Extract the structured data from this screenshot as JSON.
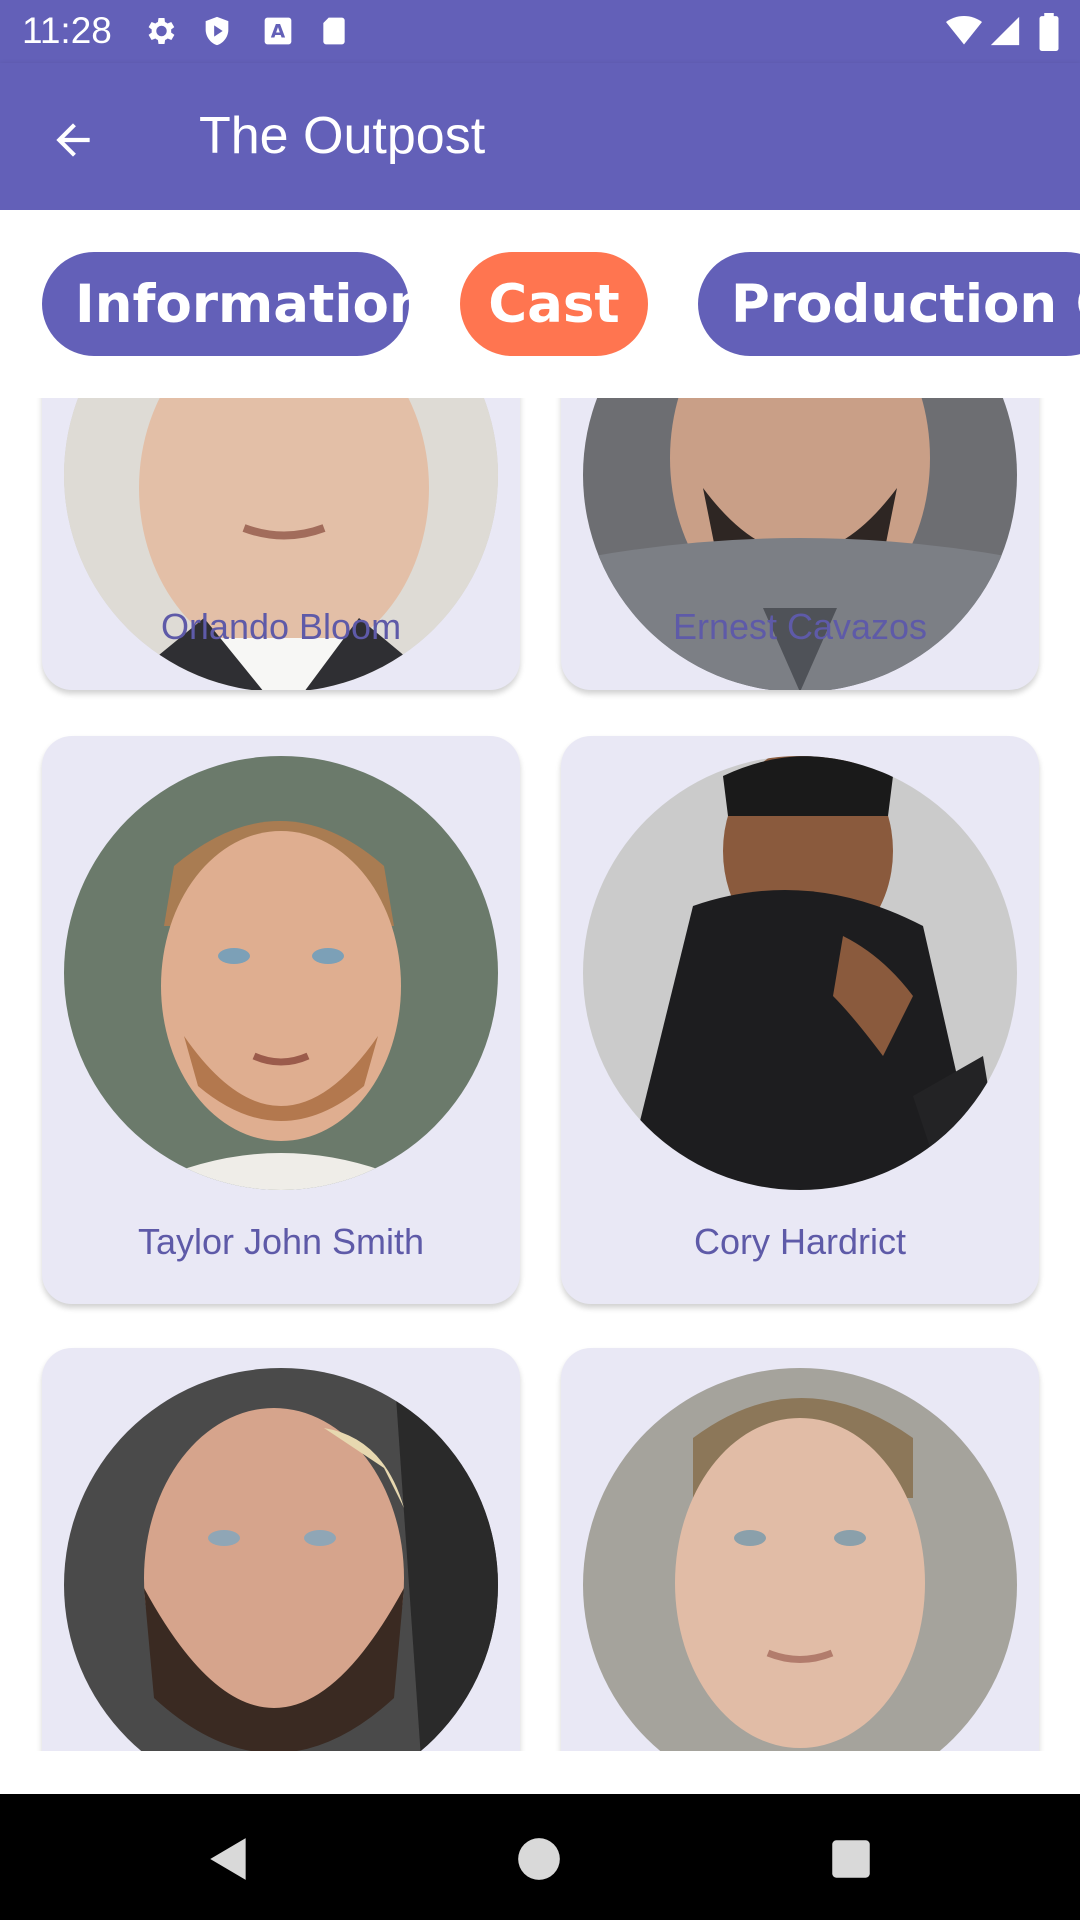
{
  "status_bar": {
    "time": "11:28",
    "icons": [
      "gear-icon",
      "shield-icon",
      "font-a-icon",
      "sd-card-icon",
      "wifi-icon",
      "signal-icon",
      "battery-icon"
    ]
  },
  "app_bar": {
    "title": "The Outpost",
    "back_icon": "arrow-left-icon"
  },
  "tabs": [
    {
      "label": "Information",
      "color": "#6360b8",
      "selected": false
    },
    {
      "label": "Cast",
      "color": "#ff7550",
      "selected": true
    },
    {
      "label": "Production Co",
      "color": "#6360b8",
      "selected": false
    }
  ],
  "cast": [
    {
      "name": "Orlando Bloom"
    },
    {
      "name": "Ernest Cavazos"
    },
    {
      "name": "Taylor John Smith"
    },
    {
      "name": "Cory Hardrict"
    },
    {
      "name": ""
    },
    {
      "name": ""
    }
  ],
  "colors": {
    "primary": "#6360b8",
    "accent": "#ff7550",
    "card_bg": "#e9e8f5",
    "name_text": "#5e5aa8"
  },
  "nav_bar": {
    "icons": [
      "back-triangle-icon",
      "home-circle-icon",
      "recents-square-icon"
    ]
  }
}
